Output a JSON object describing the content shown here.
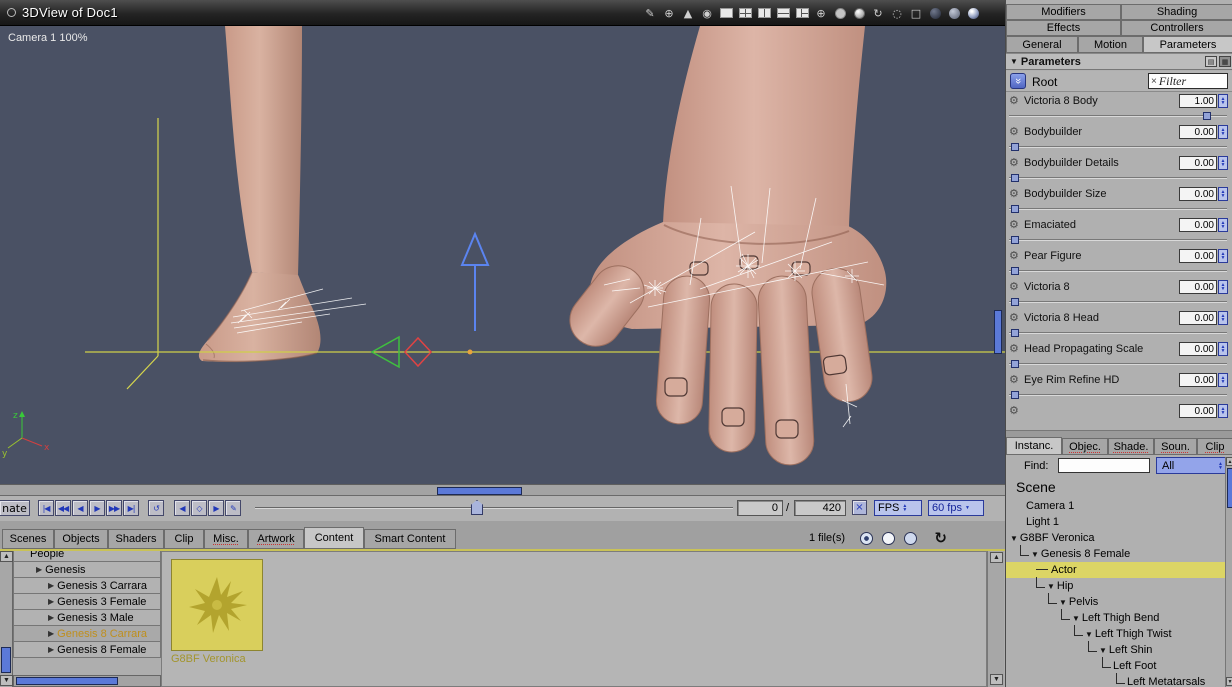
{
  "titlebar": {
    "title": "3DView of Doc1"
  },
  "viewport": {
    "camera_label": "Camera 1 100%",
    "axis_labels": {
      "x": "x",
      "y": "y",
      "z": "z"
    }
  },
  "timeline": {
    "animate_button": "nate",
    "frame_current": "0",
    "frame_separator": "/",
    "frame_total": "420",
    "fps_button": "FPS",
    "fps_value": "60 fps"
  },
  "browser_tabs": {
    "labels": [
      "Scenes",
      "Objects",
      "Shaders",
      "Clip",
      "Misc.",
      "Artwork",
      "Content",
      "Smart Content"
    ],
    "active": "Content",
    "file_count": "1 file(s)"
  },
  "browser": {
    "tree_items": [
      "People",
      "Genesis",
      "Genesis 3 Carrara",
      "Genesis 3 Female",
      "Genesis 3 Male",
      "Genesis 8 Carrara",
      "Genesis 8 Female"
    ],
    "selected_item": "Genesis 8 Carrara",
    "thumbnail_label": "G8BF Veronica"
  },
  "right_panel": {
    "tabs": {
      "row1": [
        "Modifiers",
        "Shading"
      ],
      "row2": [
        "Effects",
        "Controllers"
      ],
      "row3": [
        "General",
        "Motion",
        "Parameters"
      ],
      "active": "Parameters"
    },
    "parameters_header": "Parameters",
    "root_row": {
      "label": "Root",
      "filter_text": "Filter"
    },
    "params": [
      {
        "label": "Victoria 8 Body",
        "value": "1.00"
      },
      {
        "label": "Bodybuilder",
        "value": "0.00"
      },
      {
        "label": "Bodybuilder Details",
        "value": "0.00"
      },
      {
        "label": "Bodybuilder Size",
        "value": "0.00"
      },
      {
        "label": "Emaciated",
        "value": "0.00"
      },
      {
        "label": "Pear Figure",
        "value": "0.00"
      },
      {
        "label": "Victoria 8",
        "value": "0.00"
      },
      {
        "label": "Victoria 8 Head",
        "value": "0.00"
      },
      {
        "label": "Head Propagating Scale",
        "value": "0.00"
      },
      {
        "label": "Eye Rim Refine HD",
        "value": "0.00"
      },
      {
        "label": "",
        "value": "0.00"
      }
    ],
    "lower_tabs": {
      "labels": [
        "Instanc.",
        "Objec.",
        "Shade.",
        "Soun.",
        "Clip"
      ],
      "active": "Instanc."
    },
    "find": {
      "label": "Find:",
      "scope": "All"
    },
    "scene": {
      "header": "Scene",
      "tree": [
        {
          "label": "Camera 1"
        },
        {
          "label": "Light 1"
        },
        {
          "label": "G8BF Veronica"
        },
        {
          "label": "Genesis 8 Female"
        },
        {
          "label": "Actor"
        },
        {
          "label": "Hip"
        },
        {
          "label": "Pelvis"
        },
        {
          "label": "Left Thigh Bend"
        },
        {
          "label": "Left Thigh Twist"
        },
        {
          "label": "Left Shin"
        },
        {
          "label": "Left Foot"
        },
        {
          "label": "Left Metatarsals"
        }
      ],
      "selected": "Actor"
    }
  },
  "colors": {
    "accent_blue": "#5b79d8",
    "selection_yellow": "#dcd565",
    "viewport_bg": "#4a5164",
    "gold_text": "#bf8f1d",
    "thumbnail_yellow": "#d9cf5c"
  },
  "icons": {
    "gear-icon": "⚙",
    "collapse-icon": "▼",
    "expand-icon": "▶",
    "filter-clear-icon": "×",
    "loop-icon": "↺",
    "refresh-icon": "↻"
  }
}
